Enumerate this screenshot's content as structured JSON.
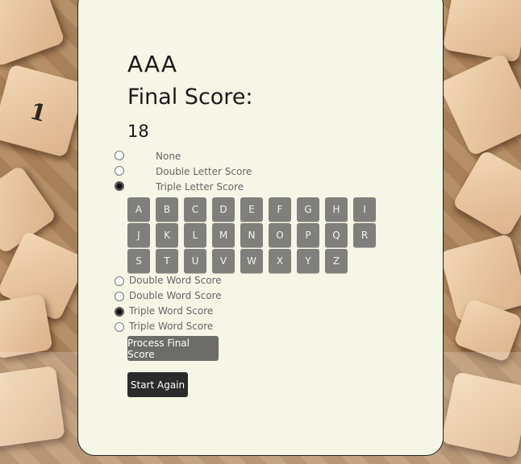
{
  "player": {
    "name": "AAA"
  },
  "score": {
    "label": "Final Score:",
    "value": "18"
  },
  "letter_modifiers": [
    {
      "label": "None",
      "selected": false
    },
    {
      "label": "Double Letter Score",
      "selected": false
    },
    {
      "label": "Triple Letter Score",
      "selected": true
    }
  ],
  "letters_rows": [
    [
      "A",
      "B",
      "C",
      "D",
      "E",
      "F",
      "G",
      "H",
      "I"
    ],
    [
      "J",
      "K",
      "L",
      "M",
      "N",
      "O",
      "P",
      "Q",
      "R"
    ],
    [
      "S",
      "T",
      "U",
      "V",
      "W",
      "X",
      "Y",
      "Z"
    ]
  ],
  "word_modifiers": [
    {
      "label": "Double Word Score",
      "selected": false
    },
    {
      "label": "Double Word Score",
      "selected": false
    },
    {
      "label": "Triple Word Score",
      "selected": true
    },
    {
      "label": "Triple Word Score",
      "selected": false
    }
  ],
  "buttons": {
    "process": "Process Final Score",
    "restart": "Start Again"
  },
  "colors": {
    "card": "#f6f6e7",
    "letter_tile": "#7f7f7b",
    "process_button": "#6c6c69",
    "restart_button": "#2b2b2b"
  }
}
